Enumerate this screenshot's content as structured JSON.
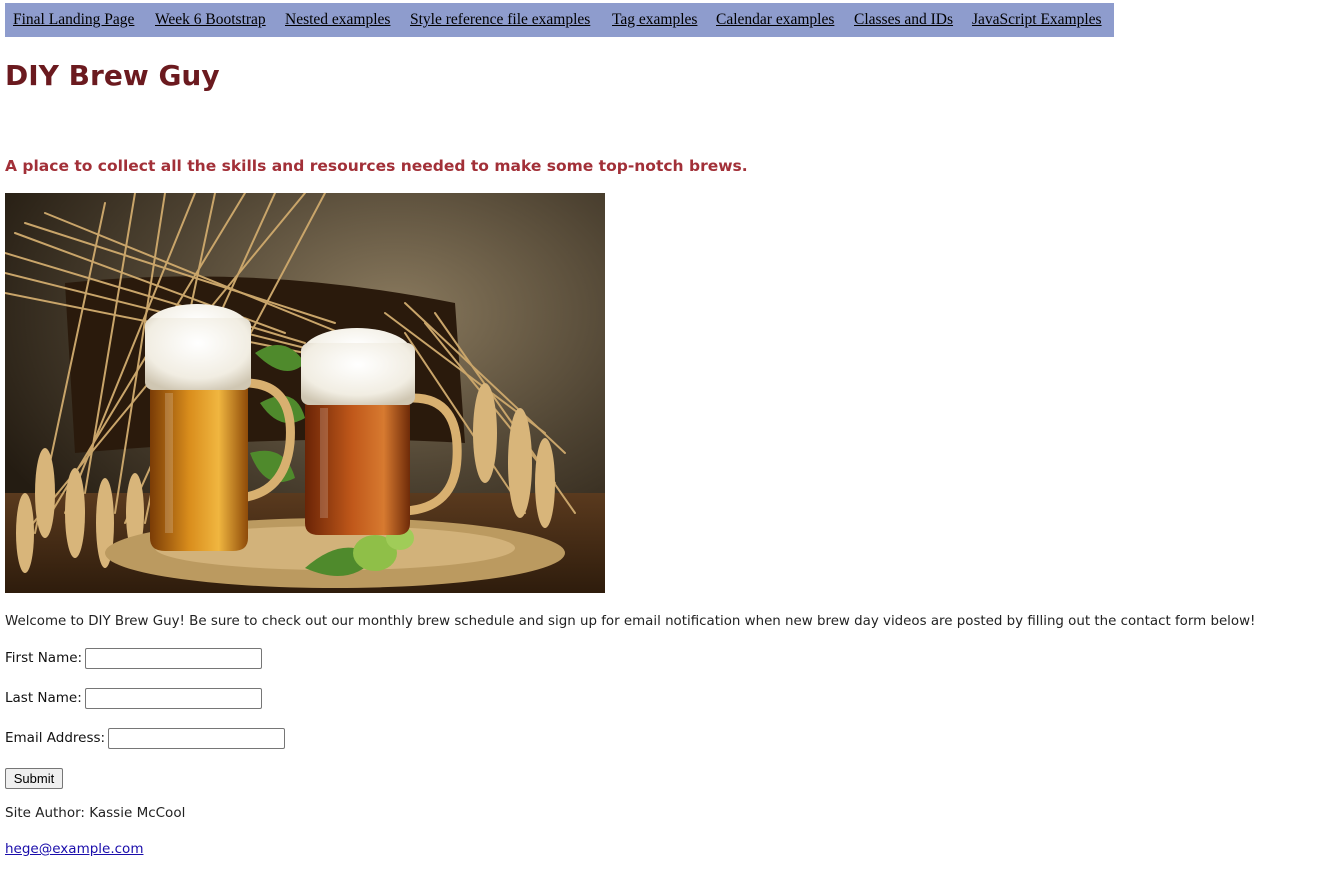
{
  "nav": {
    "items": [
      {
        "label": "Final Landing Page"
      },
      {
        "label": "Week 6 Bootstrap"
      },
      {
        "label": "Nested examples"
      },
      {
        "label": "Style reference file examples"
      },
      {
        "label": "Tag examples"
      },
      {
        "label": "Calendar examples"
      },
      {
        "label": "Classes and IDs"
      },
      {
        "label": "JavaScript Examples"
      }
    ]
  },
  "header": {
    "title": "DIY Brew Guy",
    "tagline": "A place to collect all the skills and resources needed to make some top-notch brews."
  },
  "main": {
    "welcome": "Welcome to DIY Brew Guy! Be sure to check out our monthly brew schedule and sign up for email notification when new brew day videos are posted by filling out the contact form below!"
  },
  "form": {
    "first_name_label": "First Name:",
    "first_name_value": "",
    "last_name_label": "Last Name:",
    "last_name_value": "",
    "email_label": "Email Address:",
    "email_value": "",
    "submit_label": "Submit"
  },
  "footer": {
    "author": "Site Author: Kassie McCool",
    "email": "hege@example.com"
  },
  "colors": {
    "nav_bg": "#8e9ccd",
    "title": "#6b1a1f",
    "tagline": "#a23038",
    "link": "#1a0dab"
  }
}
